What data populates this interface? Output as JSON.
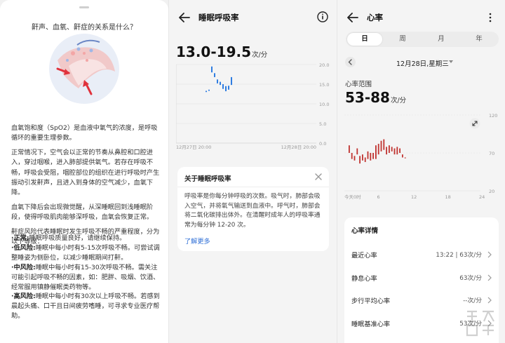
{
  "panel1": {
    "question": "鼾声、血氧、鼾症的关系是什么？",
    "paragraphs": [
      "血氧饱和度（SpO2）是血液中氧气的浓度，是呼吸循环的重要生理参数。",
      "正常情况下，空气会以正常的节奏从鼻腔和口腔进入，穿过咽喉，进入肺部提供氧气。若存在呼吸不畅，呼吸会受阻，咽腔部位的组织在进行呼吸时产生振动引发鼾声，且进入到身体的空气减少，血氧下降。",
      "血氧下降后会出现微觉醒，从深睡眠回到浅睡眠阶段，使得呼吸肌肉能够深呼吸，血氧会恢复正常。",
      "鼾症风险代表睡眠时发生呼吸不畅的严重程度，分为以下等级："
    ],
    "levels": [
      {
        "name": "·正常:",
        "text": "睡眠呼吸质量良好，请继续保持。"
      },
      {
        "name": "·低风险:",
        "text": "睡眠中每小时有5-15次呼吸不畅。可尝试调整睡姿为侧卧位，以减少睡眠期间打鼾。"
      },
      {
        "name": "·中风险:",
        "text": "睡眠中每小时有15-30次呼吸不畅。需关注可能引起呼吸不畅的因素，如：肥胖、吸烟、饮酒、经常服用镇静催眠类药物等。"
      },
      {
        "name": "·高风险:",
        "text": "睡眠中每小时有30次以上呼吸不畅。若感到晨起头痛、口干且日间疲劳嗜睡，可寻求专业医疗帮助。"
      }
    ]
  },
  "panel2": {
    "title": "睡眠呼吸率",
    "value": "13.0-19.5",
    "unit": "次/分",
    "card": {
      "title": "关于睡眠呼吸率",
      "body": "呼吸率是你每分钟呼吸的次数。吸气时，肺部会吸入空气，并将氧气输送到血液中。呼气时，肺部会将二氧化碳排出体外。在清醒时成年人的呼吸率通常为每分钟 12-20 次。",
      "link": "了解更多"
    }
  },
  "panel3": {
    "title": "心率",
    "tabs": [
      "日",
      "周",
      "月",
      "年"
    ],
    "active_tab": 0,
    "date": "12月28日,星期三",
    "range_label": "心率范围",
    "range_value": "53-88",
    "range_unit": "次/分",
    "details_title": "心率详情",
    "details": [
      {
        "label": "最近心率",
        "value": "13:22 | 63次/分"
      },
      {
        "label": "静息心率",
        "value": "63次/分"
      },
      {
        "label": "步行平均心率",
        "value": "--次/分"
      },
      {
        "label": "睡眠基准心率",
        "value": "53次/分"
      }
    ]
  },
  "chart_data": [
    {
      "type": "bar",
      "chart_kind": "range-candle",
      "yticks": [
        "20.0",
        "15.0",
        "10.0",
        "5.0",
        "0.0"
      ],
      "ylim": [
        0,
        20
      ],
      "xlabels": [
        "12月27日 20:00",
        "12月28日 20:00"
      ],
      "series": [
        {
          "values": [
            [
              13.0,
              13.3
            ],
            [
              13.3,
              13.6
            ],
            [
              18.0,
              19.5
            ],
            [
              16.8,
              17.8
            ],
            [
              15.2,
              16.2
            ],
            [
              14.8,
              15.6
            ],
            [
              13.8,
              15.0
            ],
            [
              13.2,
              14.5
            ],
            [
              13.6,
              14.6
            ],
            [
              14.8,
              16.8
            ]
          ]
        }
      ],
      "ymin": 13.0,
      "ymax": 19.5,
      "colors": {
        "bars": "#2f7de1"
      },
      "grid": true
    },
    {
      "type": "bar",
      "chart_kind": "range-candle",
      "yticks": [
        "120",
        "70",
        "20"
      ],
      "ylim": [
        20,
        120
      ],
      "xlabels": [
        "今天0时",
        "6",
        "12",
        "18",
        "24"
      ],
      "series": [
        {
          "values": [
            [
              70,
              80
            ],
            [
              62,
              70
            ],
            [
              60,
              66
            ],
            [
              68,
              76
            ],
            [
              56,
              66
            ],
            [
              60,
              68
            ],
            [
              58,
              64
            ],
            [
              62,
              72
            ],
            [
              60,
              70
            ],
            [
              62,
              70
            ],
            [
              62,
              80
            ],
            [
              68,
              82
            ],
            [
              72,
              86
            ],
            [
              74,
              88
            ],
            [
              68,
              78
            ],
            [
              70,
              80
            ],
            [
              72,
              78
            ],
            [
              68,
              76
            ],
            [
              68,
              78
            ],
            [
              70,
              76
            ],
            [
              64,
              68
            ],
            [
              64,
              64
            ]
          ]
        }
      ],
      "colors": {
        "bars": "#c0322f"
      },
      "grid": true
    }
  ]
}
